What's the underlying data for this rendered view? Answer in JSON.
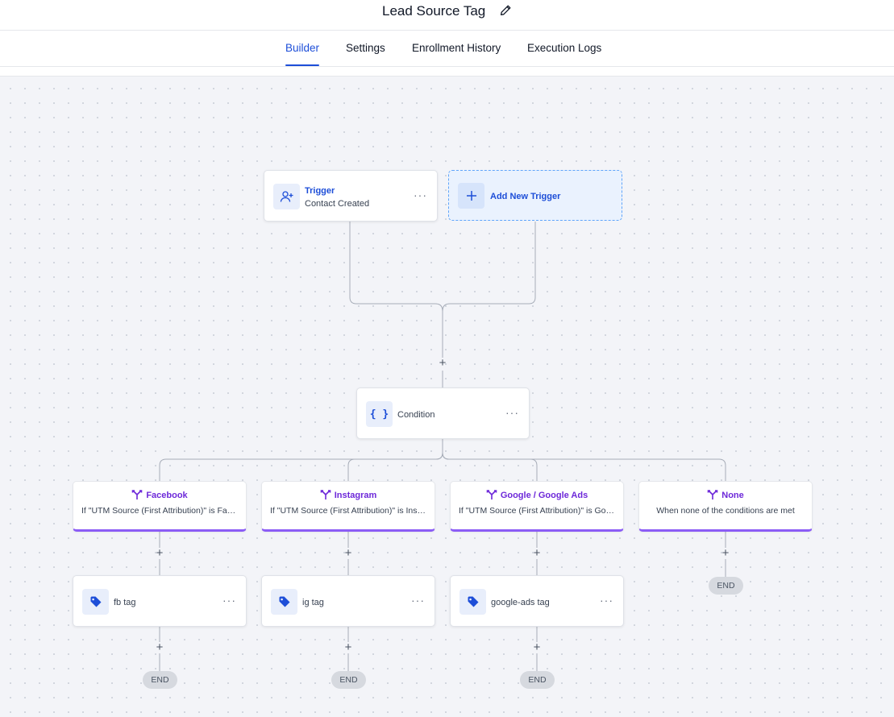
{
  "header": {
    "title": "Lead Source Tag"
  },
  "tabs": [
    {
      "label": "Builder",
      "active": true
    },
    {
      "label": "Settings",
      "active": false
    },
    {
      "label": "Enrollment History",
      "active": false
    },
    {
      "label": "Execution Logs",
      "active": false
    }
  ],
  "trigger": {
    "title": "Trigger",
    "subtitle": "Contact Created",
    "icon": "user-plus-icon"
  },
  "add_trigger": {
    "label": "Add New Trigger",
    "icon": "plus-icon"
  },
  "condition": {
    "label": "Condition",
    "icon": "braces-icon"
  },
  "branches": [
    {
      "name": "Facebook",
      "description": "If \"UTM Source (First Attribution)\" is Facebook"
    },
    {
      "name": "Instagram",
      "description": "If \"UTM Source (First Attribution)\" is Instagram"
    },
    {
      "name": "Google / Google Ads",
      "description": "If \"UTM Source (First Attribution)\" is Google"
    },
    {
      "name": "None",
      "description": "When none of the conditions are met"
    }
  ],
  "actions": [
    {
      "label": "fb tag",
      "icon": "tag-icon"
    },
    {
      "label": "ig tag",
      "icon": "tag-icon"
    },
    {
      "label": "google-ads tag",
      "icon": "tag-icon"
    }
  ],
  "end_label": "END",
  "more_label": "···",
  "plus_label": "+",
  "colors": {
    "accent": "#1d4ed8",
    "branch": "#8b5cf6",
    "canvas": "#f3f4f8"
  }
}
